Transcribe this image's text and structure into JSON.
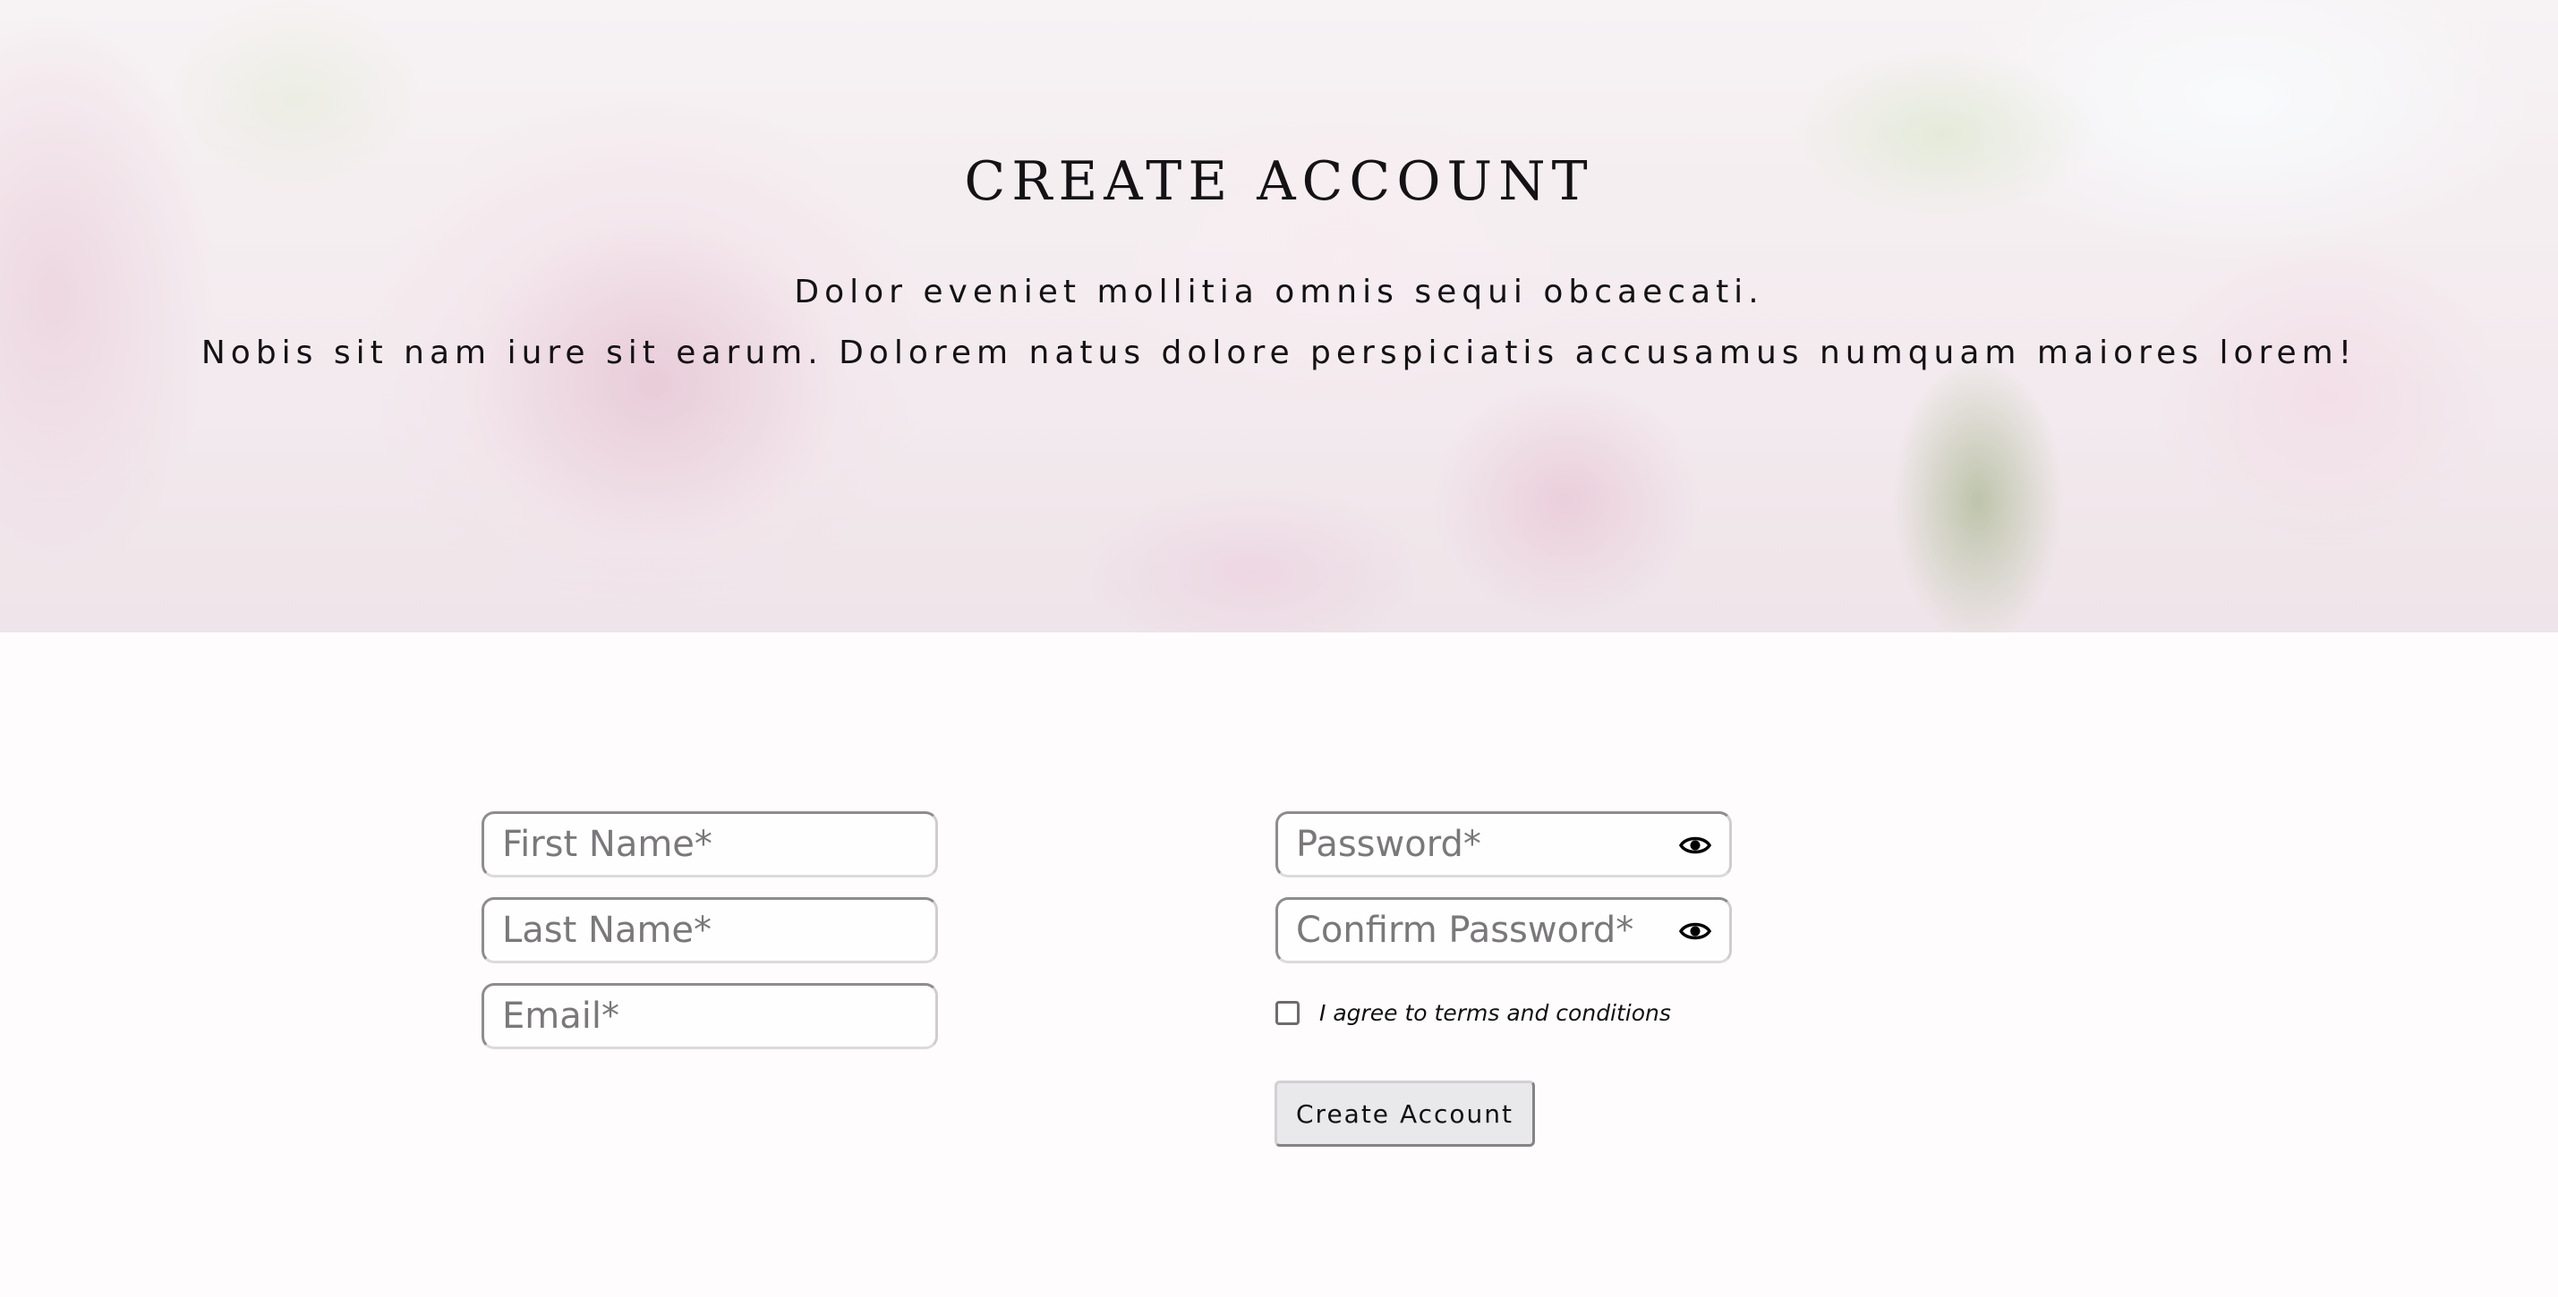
{
  "hero": {
    "title": "CREATE ACCOUNT",
    "subtitle_line1": "Dolor eveniet mollitia omnis sequi obcaecati.",
    "subtitle_line2": "Nobis sit nam iure sit earum. Dolorem natus dolore perspiciatis accusamus numquam maiores lorem!"
  },
  "form": {
    "first_name": {
      "placeholder": "First Name*",
      "value": ""
    },
    "last_name": {
      "placeholder": "Last Name*",
      "value": ""
    },
    "email": {
      "placeholder": "Email*",
      "value": ""
    },
    "password": {
      "placeholder": "Password*",
      "value": "",
      "icon": "eye-icon"
    },
    "confirm_password": {
      "placeholder": "Confirm Password*",
      "value": "",
      "icon": "eye-icon"
    },
    "terms": {
      "label": "I agree to terms and conditions",
      "checked": false
    },
    "submit_label": "Create Account"
  },
  "colors": {
    "background": "#fefcfd",
    "text": "#141214",
    "placeholder": "#7a787a",
    "button_bg": "#e9e8ea"
  }
}
